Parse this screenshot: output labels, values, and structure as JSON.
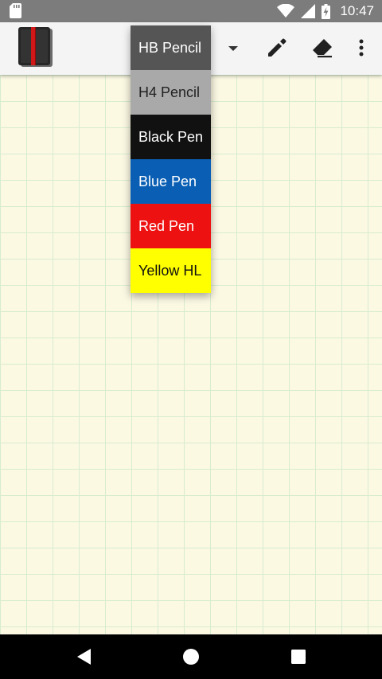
{
  "status_bar": {
    "time": "10:47",
    "icons": [
      "sd-card-icon",
      "wifi-icon",
      "cellular-signal-icon",
      "battery-charging-icon"
    ]
  },
  "app_bar": {
    "icons": [
      "notebook-logo-icon",
      "dropdown-arrow-icon",
      "pen-icon",
      "eraser-icon",
      "more-vert-icon"
    ]
  },
  "pen_menu": {
    "items": [
      {
        "label": "HB Pencil",
        "bg": "#555555",
        "fg": "#ffffff"
      },
      {
        "label": "H4 Pencil",
        "bg": "#a9a9a9",
        "fg": "#222222"
      },
      {
        "label": "Black Pen",
        "bg": "#111111",
        "fg": "#ffffff"
      },
      {
        "label": "Blue Pen",
        "bg": "#0a5fb4",
        "fg": "#ffffff"
      },
      {
        "label": "Red Pen",
        "bg": "#ee1111",
        "fg": "#ffffff"
      },
      {
        "label": "Yellow HL",
        "bg": "#ffff00",
        "fg": "#111111"
      }
    ]
  },
  "canvas": {
    "background": "#fbf9e2",
    "grid_color": "#d8ecd0"
  },
  "nav_bar": {
    "icons": [
      "back-icon",
      "home-icon",
      "recents-icon"
    ]
  }
}
